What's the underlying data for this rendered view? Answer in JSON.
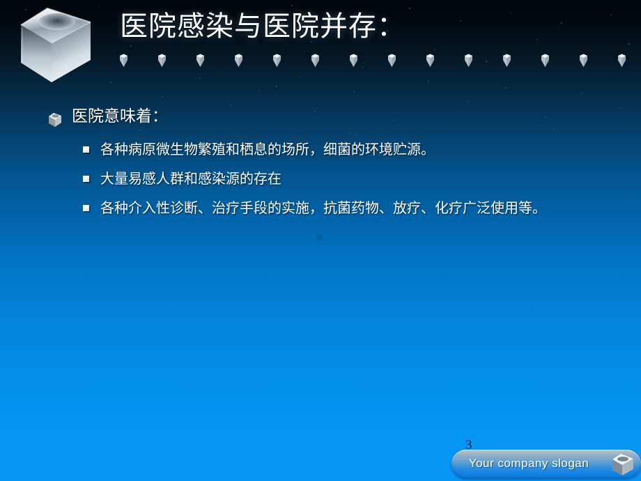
{
  "slide": {
    "title": "医院感染与医院并存：",
    "page_number": "3",
    "background_top_color": "#010609",
    "background_bottom_color": "#0a97f7"
  },
  "header": {
    "logo_icon": "chrome-cube-logo",
    "gem_icon": "gem-icon",
    "gem_count": 14
  },
  "content": {
    "level1": {
      "icon": "cube-bullet-icon",
      "text": "医院意味着："
    },
    "level2": [
      {
        "marker": "square-bullet-marker",
        "text": "各种病原微生物繁殖和栖息的场所，细菌的环境贮源。"
      },
      {
        "marker": "square-bullet-marker",
        "text": "大量易感人群和感染源的存在"
      },
      {
        "marker": "square-bullet-marker",
        "text": "各种介入性诊断、治疗手段的实施，抗菌药物、放疗、化疗广泛使用等。"
      }
    ]
  },
  "footer": {
    "slogan": "Your company slogan",
    "cube_icon": "cube-icon",
    "bar_top_color": "#bcc6cd",
    "bar_bottom_color": "#0d7ddf"
  }
}
